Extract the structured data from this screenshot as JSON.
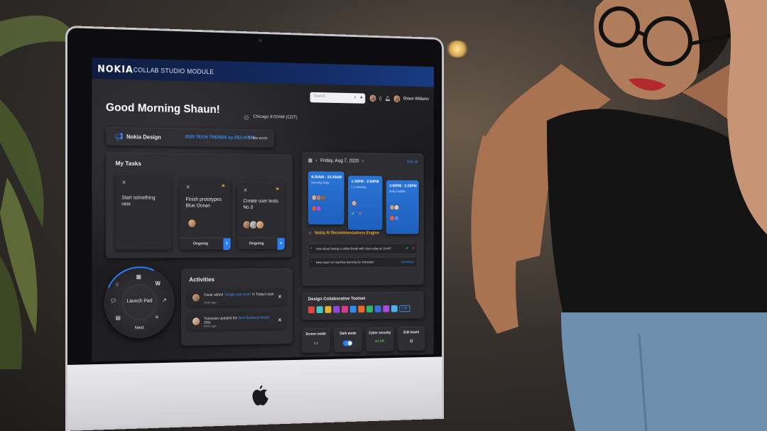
{
  "app": {
    "brand": "NOKIA",
    "module": "COLLAB STUDIO MODULE",
    "search_placeholder": "Search",
    "user_name": "Shaun Williams"
  },
  "greeting": "Good Morning Shaun!",
  "weather": "Chicago 8:00AM (CDT)",
  "design_bar": {
    "name": "Nokia Design",
    "trend_link": "2020 TECH TRENDS by DELOITTE",
    "posts": "5 new posts"
  },
  "tasks": {
    "title": "My Tasks",
    "items": [
      {
        "text": "Start something new",
        "status": ""
      },
      {
        "text": "Finish prototypes Blue Ocean",
        "status": "Ongoing"
      },
      {
        "text": "Create user tests No.3",
        "status": "Ongoing"
      }
    ]
  },
  "launch_pad": {
    "label": "Launch Pad",
    "next": "Next"
  },
  "activities": {
    "title": "Activities",
    "items": [
      {
        "actor": "Cesar",
        "action": "added",
        "link": "\"Jungle user tests\"",
        "rest": "in Today's task",
        "time": "2min ago"
      },
      {
        "actor": "Yuanyuan",
        "action": "updated the",
        "link": "Next Business Model",
        "rest": "20%",
        "time": "5min ago"
      }
    ]
  },
  "calendar": {
    "date": "Friday, Aug 7, 2020",
    "view_link": "View all",
    "events": [
      {
        "time": "8:30AM - 10:30AM",
        "title": "Morning Daily"
      },
      {
        "time": "1:30PM - 2:00PM",
        "title": "1:1 Meeting"
      },
      {
        "time": "2:00PM - 3:30PM",
        "title": "Daily Huddle"
      }
    ]
  },
  "ai_engine": {
    "title": "Nokia AI Recommendations Engine",
    "items": [
      {
        "text": "How about having a coffee break with Jose today at 11AM?"
      },
      {
        "text": "New report on machine learning for Telematic",
        "link": "Download"
      }
    ]
  },
  "toolset": {
    "title": "Design Collaborative Toolset",
    "edit_label": "Edit",
    "tool_colors": [
      "#e0483b",
      "#41c7c7",
      "#e1b52e",
      "#8c4ad8",
      "#d83b8a",
      "#2f8cf0",
      "#f0682a",
      "#2fb86b",
      "#3c6ee0",
      "#a64de0",
      "#4ab0f0"
    ]
  },
  "quick_buttons": [
    {
      "label": "Screen mode"
    },
    {
      "label": "Dark mode"
    },
    {
      "label": "Cyber security",
      "value": "Lock"
    },
    {
      "label": "Edit board"
    }
  ],
  "colors": {
    "accent": "#2d7df0",
    "header": "#132a63",
    "ai_title": "#e6a63a"
  }
}
